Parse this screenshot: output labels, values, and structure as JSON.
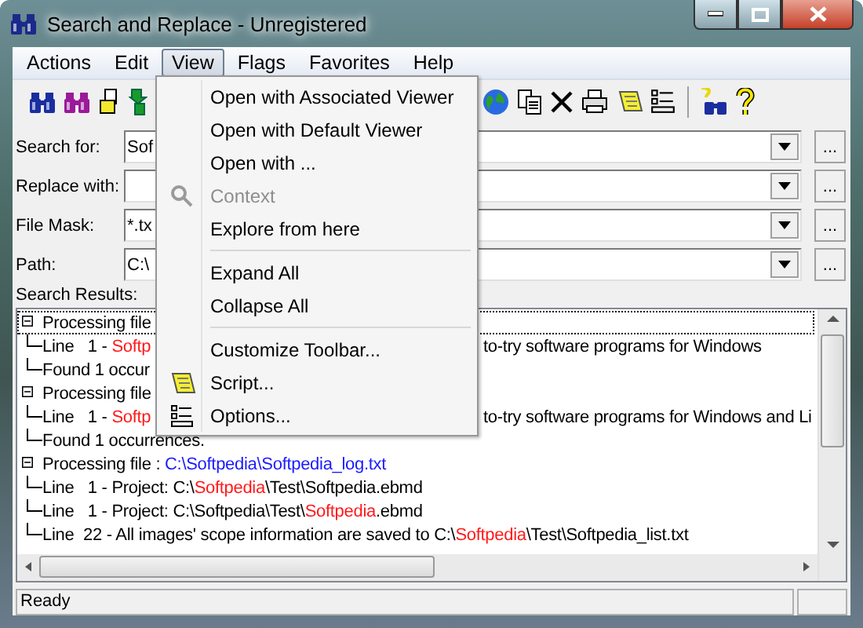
{
  "window": {
    "title": "Search and Replace - Unregistered"
  },
  "menu_bar": [
    {
      "label": "Actions",
      "selected": false
    },
    {
      "label": "Edit",
      "selected": false
    },
    {
      "label": "View",
      "selected": true
    },
    {
      "label": "Flags",
      "selected": false
    },
    {
      "label": "Favorites",
      "selected": false
    },
    {
      "label": "Help",
      "selected": false
    }
  ],
  "form": [
    {
      "label": "Search for:",
      "value": "Sof"
    },
    {
      "label": "Replace with:"
    },
    {
      "label": "File Mask:",
      "value": "*.tx"
    },
    {
      "label": "Path:",
      "value": "C:\\"
    }
  ],
  "browse_buttons": [
    "...",
    "...",
    "...",
    "..."
  ],
  "results_label": "Search Results:",
  "results": [
    {
      "parts": [
        {
          "kind": "plain",
          "text": "Processing file"
        }
      ],
      "expanded": true,
      "focused": true,
      "children": [
        {
          "parts": [
            {
              "kind": "plain",
              "text": "Line   1 - "
            },
            {
              "kind": "match",
              "text": "Softp"
            }
          ],
          "right": [
            {
              "kind": "plain",
              "text": "to-try software programs for Windows"
            }
          ],
          "focused": false
        },
        {
          "parts": [
            {
              "kind": "plain",
              "text": "Found 1 occur"
            }
          ],
          "focused": false
        }
      ]
    },
    {
      "parts": [
        {
          "kind": "plain",
          "text": "Processing file"
        }
      ],
      "expanded": true,
      "focused": false,
      "children": [
        {
          "parts": [
            {
              "kind": "plain",
              "text": "Line   1 - "
            },
            {
              "kind": "match",
              "text": "Softp"
            }
          ],
          "right": [
            {
              "kind": "plain",
              "text": "to-try software programs for Windows and Li"
            }
          ],
          "focused": false
        },
        {
          "parts": [
            {
              "kind": "plain",
              "text": "Found 1 occurrences."
            }
          ],
          "focused": false
        }
      ]
    },
    {
      "parts": [
        {
          "kind": "plain",
          "text": "Processing file : "
        },
        {
          "kind": "path",
          "text": "C:\\Softpedia\\Softpedia_log.txt"
        }
      ],
      "expanded": true,
      "focused": false,
      "children": [
        {
          "parts": [
            {
              "kind": "plain",
              "text": "Line   1 - Project: C:\\"
            },
            {
              "kind": "match",
              "text": "Softpedia"
            },
            {
              "kind": "plain",
              "text": "\\Test\\Softpedia.ebmd"
            }
          ],
          "focused": false
        },
        {
          "parts": [
            {
              "kind": "plain",
              "text": "Line   1 - Project: C:\\Softpedia\\Test\\"
            },
            {
              "kind": "match",
              "text": "Softpedia"
            },
            {
              "kind": "plain",
              "text": ".ebmd"
            }
          ],
          "focused": false
        },
        {
          "parts": [
            {
              "kind": "plain",
              "text": "Line  22 - All images' scope information are saved to C:\\"
            },
            {
              "kind": "match",
              "text": "Softpedia"
            },
            {
              "kind": "plain",
              "text": "\\Test\\Softpedia_list.txt"
            }
          ],
          "focused": false
        }
      ]
    }
  ],
  "view_menu": [
    {
      "kind": "item",
      "label": "Open with Associated Viewer",
      "disabled": false,
      "icon": false
    },
    {
      "kind": "item",
      "label": "Open with Default Viewer",
      "disabled": false,
      "icon": false
    },
    {
      "kind": "item",
      "label": "Open with ...",
      "disabled": false,
      "icon": false
    },
    {
      "kind": "item",
      "label": "Context",
      "disabled": true,
      "icon": true
    },
    {
      "kind": "item",
      "label": "Explore from here",
      "disabled": false,
      "icon": false
    },
    {
      "kind": "separator"
    },
    {
      "kind": "item",
      "label": "Expand All",
      "disabled": false,
      "icon": false
    },
    {
      "kind": "item",
      "label": "Collapse All",
      "disabled": false,
      "icon": false
    },
    {
      "kind": "separator"
    },
    {
      "kind": "item",
      "label": "Customize Toolbar...",
      "disabled": false,
      "icon": false
    },
    {
      "kind": "item",
      "label": "Script...",
      "disabled": false,
      "icon": true
    },
    {
      "kind": "item",
      "label": "Options...",
      "disabled": false,
      "icon": true
    }
  ],
  "status_bar": {
    "text": "Ready"
  }
}
